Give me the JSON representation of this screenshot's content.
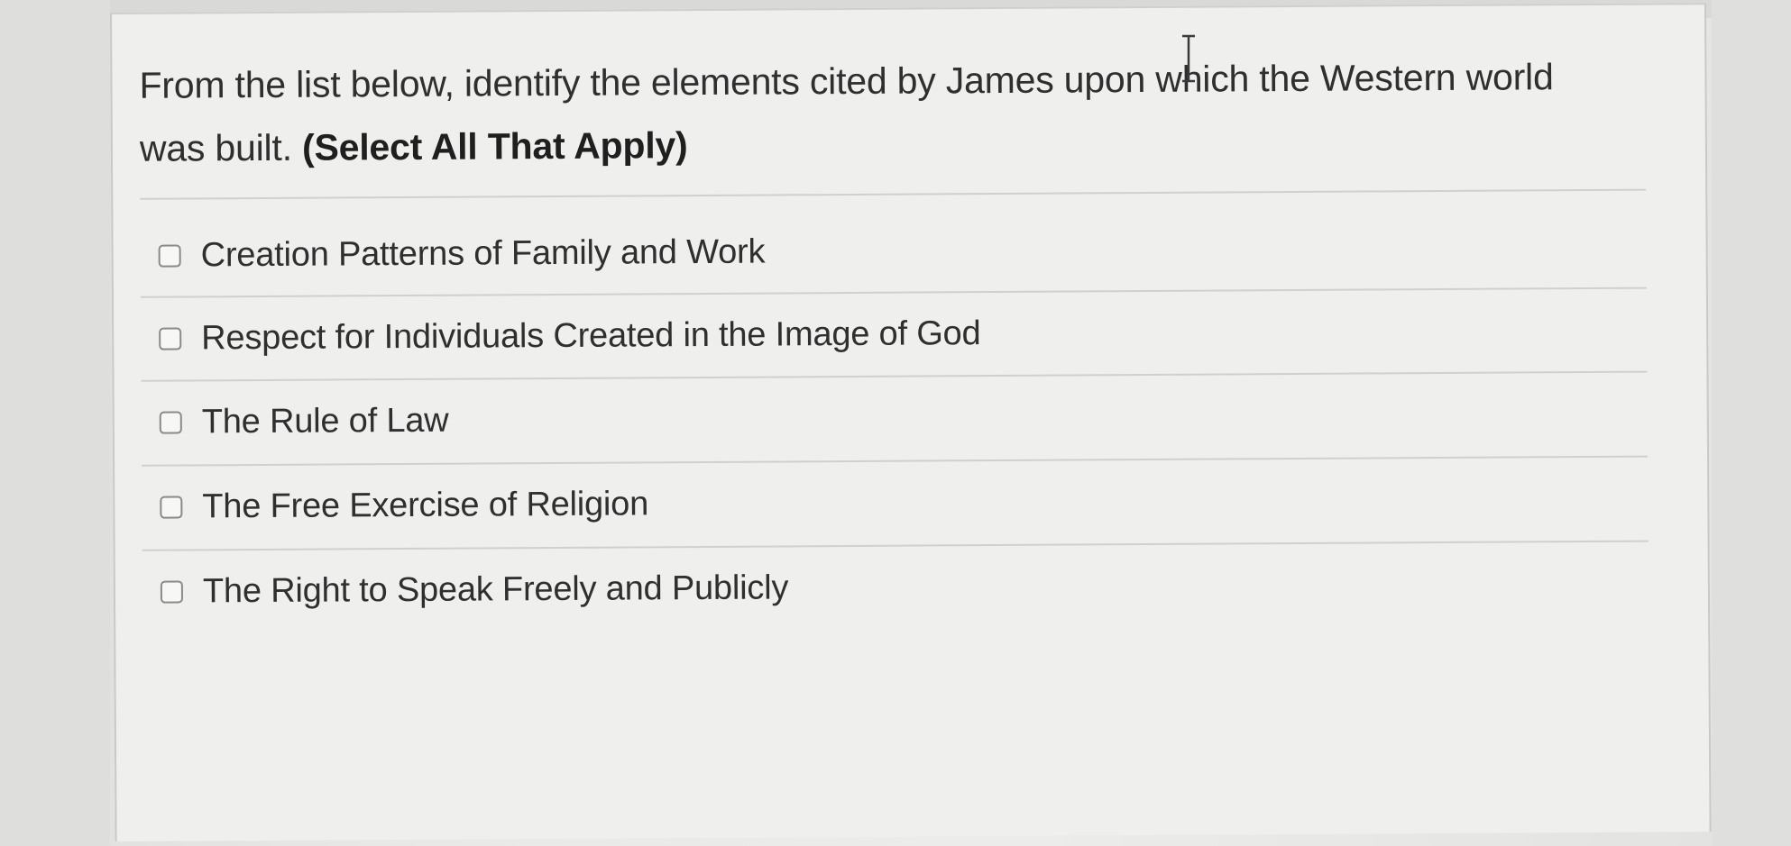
{
  "question": {
    "text": "From the list below, identify the elements cited by James upon which the Western world was built. ",
    "emphasis": "(Select All That Apply)"
  },
  "answers": [
    {
      "label": "Creation Patterns of Family and Work",
      "checked": false
    },
    {
      "label": "Respect for Individuals Created in the Image of God",
      "checked": false
    },
    {
      "label": "The Rule of Law",
      "checked": false
    },
    {
      "label": "The Free Exercise of Religion",
      "checked": false
    },
    {
      "label": "The Right to Speak Freely and Publicly",
      "checked": false
    }
  ],
  "cursor": {
    "icon": "text-cursor-icon"
  }
}
